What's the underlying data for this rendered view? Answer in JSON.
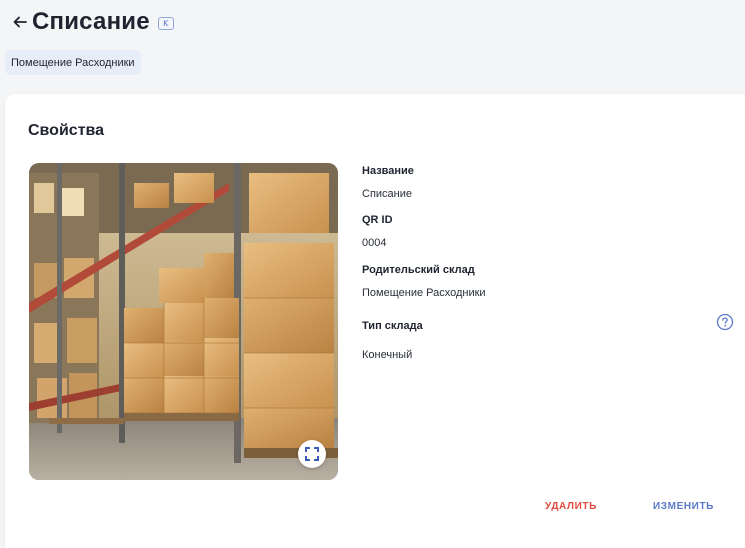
{
  "header": {
    "title": "Списание",
    "shortcut_badge": "K",
    "back_icon": "arrow-left-icon"
  },
  "breadcrumb": {
    "label": "Помещение Расходники"
  },
  "properties": {
    "section_title": "Свойства",
    "image_alt": "warehouse-photo",
    "fields": [
      {
        "label": "Название",
        "value": "Списание"
      },
      {
        "label": "QR ID",
        "value": "0004"
      },
      {
        "label": "Родительский склад",
        "value": "Помещение Расходники"
      },
      {
        "label": "Тип склада",
        "value": "Конечный"
      }
    ]
  },
  "actions": {
    "delete_label": "УДАЛИТЬ",
    "edit_label": "ИЗМЕНИТЬ"
  },
  "colors": {
    "accent": "#5c78c8",
    "danger": "#e04a3f",
    "background": "#f4f5f7",
    "breadcrumb_bg": "#e7edf8"
  }
}
